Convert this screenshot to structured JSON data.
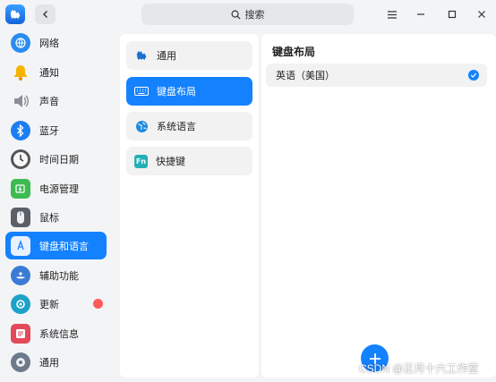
{
  "search": {
    "label": "搜索"
  },
  "sidebar": {
    "items": [
      {
        "label": "网络",
        "icon": "network-icon",
        "color": "#2b8cf0"
      },
      {
        "label": "通知",
        "icon": "bell-icon",
        "color": "#f5b400"
      },
      {
        "label": "声音",
        "icon": "speaker-icon",
        "color": "#8a8f99"
      },
      {
        "label": "蓝牙",
        "icon": "bluetooth-icon",
        "color": "#1d7ef2"
      },
      {
        "label": "时间日期",
        "icon": "clock-icon",
        "color": "#555555"
      },
      {
        "label": "电源管理",
        "icon": "battery-icon",
        "color": "#3dbb52"
      },
      {
        "label": "鼠标",
        "icon": "mouse-icon",
        "color": "#9aa0aa"
      },
      {
        "label": "键盘和语言",
        "icon": "keyboard-language-icon",
        "color": "#1482ff",
        "active": true
      },
      {
        "label": "辅助功能",
        "icon": "accessibility-icon",
        "color": "#3a7bd5"
      },
      {
        "label": "更新",
        "icon": "update-icon",
        "color": "#1da1c7",
        "badge": true
      },
      {
        "label": "系统信息",
        "icon": "system-info-icon",
        "color": "#e24a5b"
      },
      {
        "label": "通用",
        "icon": "general-icon",
        "color": "#6c7a8a"
      }
    ]
  },
  "middle": {
    "items": [
      {
        "label": "通用",
        "icon": "gear-icon"
      },
      {
        "label": "键盘布局",
        "icon": "keyboard-icon",
        "active": true
      },
      {
        "label": "系统语言",
        "icon": "globe-icon"
      },
      {
        "label": "快捷键",
        "icon": "fn-key-icon",
        "icon_text": "Fn"
      }
    ]
  },
  "content": {
    "title": "键盘布局",
    "layouts": [
      {
        "label": "英语（美国）",
        "selected": true
      }
    ]
  },
  "watermark": "CSDN @正月十六工作室",
  "colors": {
    "accent": "#1482ff",
    "badge": "#ff5a5a"
  }
}
